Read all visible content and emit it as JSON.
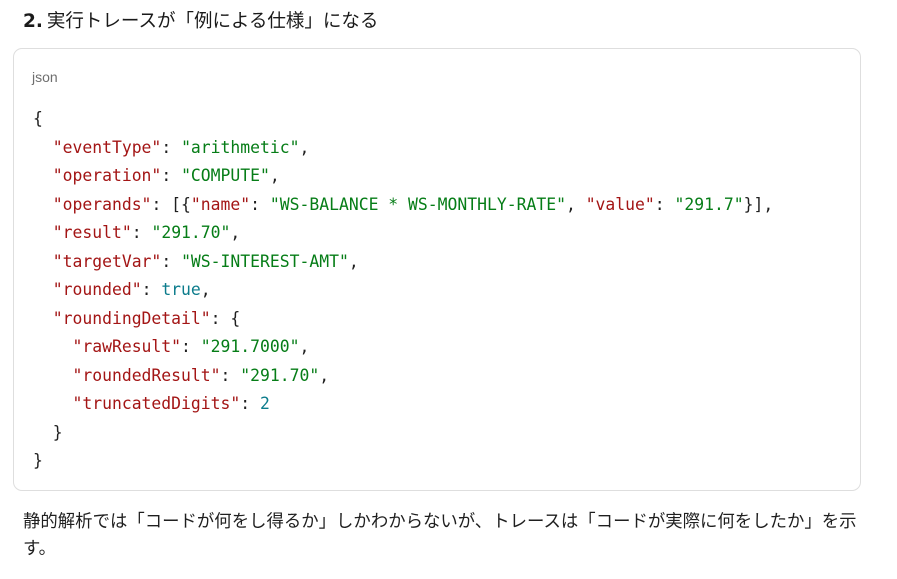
{
  "heading": {
    "number": "2.",
    "text": "実行トレースが「例による仕様」になる"
  },
  "code_block": {
    "language": "json",
    "lines": [
      [
        {
          "t": "p",
          "v": "{"
        }
      ],
      [
        {
          "t": "p",
          "v": "  "
        },
        {
          "t": "k",
          "v": "\"eventType\""
        },
        {
          "t": "p",
          "v": ": "
        },
        {
          "t": "s",
          "v": "\"arithmetic\""
        },
        {
          "t": "p",
          "v": ","
        }
      ],
      [
        {
          "t": "p",
          "v": "  "
        },
        {
          "t": "k",
          "v": "\"operation\""
        },
        {
          "t": "p",
          "v": ": "
        },
        {
          "t": "s",
          "v": "\"COMPUTE\""
        },
        {
          "t": "p",
          "v": ","
        }
      ],
      [
        {
          "t": "p",
          "v": "  "
        },
        {
          "t": "k",
          "v": "\"operands\""
        },
        {
          "t": "p",
          "v": ": [{"
        },
        {
          "t": "k",
          "v": "\"name\""
        },
        {
          "t": "p",
          "v": ": "
        },
        {
          "t": "s",
          "v": "\"WS-BALANCE * WS-MONTHLY-RATE\""
        },
        {
          "t": "p",
          "v": ", "
        },
        {
          "t": "k",
          "v": "\"value\""
        },
        {
          "t": "p",
          "v": ": "
        },
        {
          "t": "s",
          "v": "\"291.7\""
        },
        {
          "t": "p",
          "v": "}],"
        }
      ],
      [
        {
          "t": "p",
          "v": "  "
        },
        {
          "t": "k",
          "v": "\"result\""
        },
        {
          "t": "p",
          "v": ": "
        },
        {
          "t": "s",
          "v": "\"291.70\""
        },
        {
          "t": "p",
          "v": ","
        }
      ],
      [
        {
          "t": "p",
          "v": "  "
        },
        {
          "t": "k",
          "v": "\"targetVar\""
        },
        {
          "t": "p",
          "v": ": "
        },
        {
          "t": "s",
          "v": "\"WS-INTEREST-AMT\""
        },
        {
          "t": "p",
          "v": ","
        }
      ],
      [
        {
          "t": "p",
          "v": "  "
        },
        {
          "t": "k",
          "v": "\"rounded\""
        },
        {
          "t": "p",
          "v": ": "
        },
        {
          "t": "b",
          "v": "true"
        },
        {
          "t": "p",
          "v": ","
        }
      ],
      [
        {
          "t": "p",
          "v": "  "
        },
        {
          "t": "k",
          "v": "\"roundingDetail\""
        },
        {
          "t": "p",
          "v": ": {"
        }
      ],
      [
        {
          "t": "p",
          "v": "    "
        },
        {
          "t": "k",
          "v": "\"rawResult\""
        },
        {
          "t": "p",
          "v": ": "
        },
        {
          "t": "s",
          "v": "\"291.7000\""
        },
        {
          "t": "p",
          "v": ","
        }
      ],
      [
        {
          "t": "p",
          "v": "    "
        },
        {
          "t": "k",
          "v": "\"roundedResult\""
        },
        {
          "t": "p",
          "v": ": "
        },
        {
          "t": "s",
          "v": "\"291.70\""
        },
        {
          "t": "p",
          "v": ","
        }
      ],
      [
        {
          "t": "p",
          "v": "    "
        },
        {
          "t": "k",
          "v": "\"truncatedDigits\""
        },
        {
          "t": "p",
          "v": ": "
        },
        {
          "t": "n",
          "v": "2"
        }
      ],
      [
        {
          "t": "p",
          "v": "  }"
        }
      ],
      [
        {
          "t": "p",
          "v": "}"
        }
      ]
    ]
  },
  "paragraph": {
    "text": "静的解析では「コードが何をし得るか」しかわからないが、トレースは「コードが実際に何をしたか」を示す。"
  },
  "colors": {
    "key": "#a31515",
    "string": "#067d17",
    "literal": "#0c7c8c",
    "punctuation": "#1f1f1f",
    "border": "#dedede"
  }
}
